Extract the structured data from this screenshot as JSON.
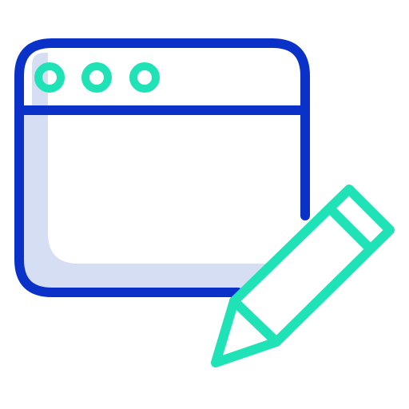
{
  "icon": {
    "name": "browser-window-edit-icon",
    "colors": {
      "window_outline": "#0a31c8",
      "window_shade": "#d5def2",
      "accent": "#1fe3b6",
      "background": "#ffffff"
    }
  }
}
